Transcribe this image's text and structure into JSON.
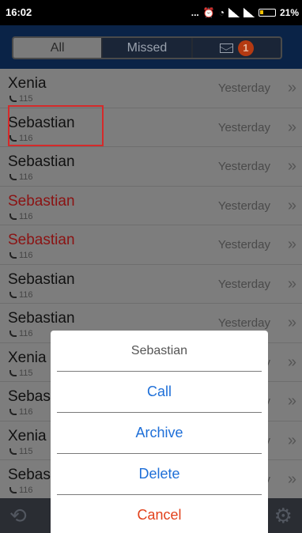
{
  "status_bar": {
    "time": "16:02",
    "more": "...",
    "alarm_icon": "alarm-icon",
    "wifi_icon": "wifi-icon",
    "battery": "21%"
  },
  "tabs": {
    "all": "All",
    "missed": "Missed",
    "messages_badge": "1"
  },
  "calls": [
    {
      "name": "Xenia",
      "number": "115",
      "time": "Yesterday",
      "missed": false
    },
    {
      "name": "Sebastian",
      "number": "116",
      "time": "Yesterday",
      "missed": false
    },
    {
      "name": "Sebastian",
      "number": "116",
      "time": "Yesterday",
      "missed": false
    },
    {
      "name": "Sebastian",
      "number": "116",
      "time": "Yesterday",
      "missed": true
    },
    {
      "name": "Sebastian",
      "number": "116",
      "time": "Yesterday",
      "missed": true
    },
    {
      "name": "Sebastian",
      "number": "116",
      "time": "Yesterday",
      "missed": false
    },
    {
      "name": "Sebastian",
      "number": "116",
      "time": "Yesterday",
      "missed": false
    },
    {
      "name": "Xenia",
      "number": "115",
      "time": "Yesterday",
      "missed": false
    },
    {
      "name": "Sebastian",
      "number": "116",
      "time": "Yesterday",
      "missed": false
    },
    {
      "name": "Xenia",
      "number": "115",
      "time": "Yesterday",
      "missed": false
    },
    {
      "name": "Sebastian",
      "number": "116",
      "time": "Yesterday",
      "missed": false
    }
  ],
  "chevron": "»",
  "dialog": {
    "title": "Sebastian",
    "call": "Call",
    "archive": "Archive",
    "delete": "Delete",
    "cancel": "Cancel"
  },
  "colors": {
    "header": "#0a2347",
    "missed_name": "#8b1313",
    "dialog_action": "#1e6fd8",
    "cancel": "#e2411b",
    "highlight": "#d52a2a"
  }
}
